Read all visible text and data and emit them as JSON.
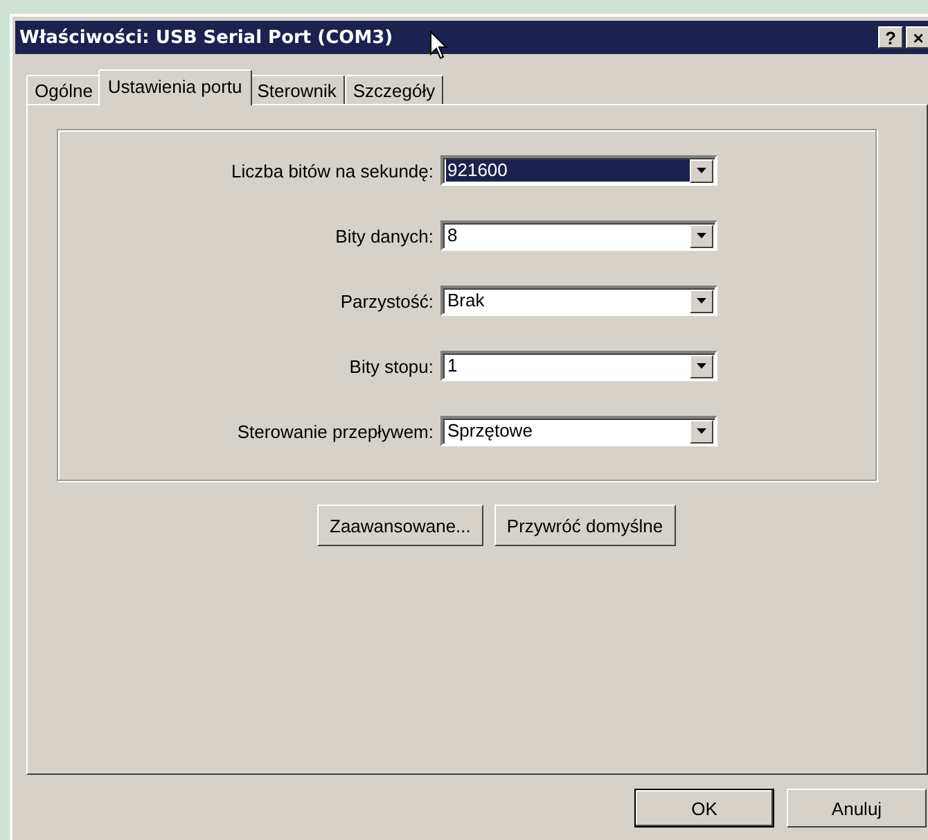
{
  "window": {
    "title": "Właściwości: USB Serial Port (COM3)",
    "title_buttons": [
      "?",
      "×"
    ]
  },
  "tabs": [
    {
      "label": "Ogólne",
      "selected": false
    },
    {
      "label": "Ustawienia portu",
      "selected": true
    },
    {
      "label": "Sterownik",
      "selected": false
    },
    {
      "label": "Szczegóły",
      "selected": false
    }
  ],
  "settings": [
    {
      "label": "Liczba bitów na sekundę:",
      "value": "921600",
      "focused": true
    },
    {
      "label": "Bity danych:",
      "value": "8",
      "focused": false
    },
    {
      "label": "Parzystość:",
      "value": "Brak",
      "focused": false
    },
    {
      "label": "Bity stopu:",
      "value": "1",
      "focused": false
    },
    {
      "label": "Sterowanie przepływem:",
      "value": "Sprzętowe",
      "focused": false
    }
  ],
  "panel_buttons": [
    "Zaawansowane...",
    "Przywróć domyślne"
  ],
  "dialog_buttons": [
    {
      "label": "OK",
      "default": true
    },
    {
      "label": "Anuluj",
      "default": false
    }
  ]
}
